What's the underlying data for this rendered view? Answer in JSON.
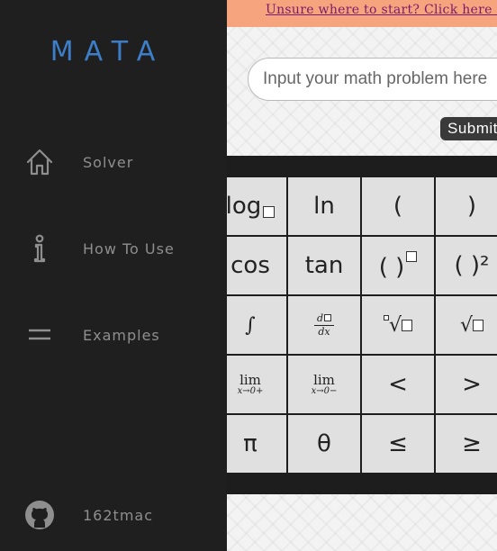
{
  "brand": {
    "logo": "MATA",
    "logo_color": "#3d7ec9"
  },
  "sidebar": {
    "items": [
      {
        "label": "Solver",
        "icon": "home-icon"
      },
      {
        "label": "How To Use",
        "icon": "info-icon"
      },
      {
        "label": "Examples",
        "icon": "menu-icon"
      }
    ],
    "github": {
      "label": "162tmac",
      "icon": "github-icon"
    }
  },
  "banner": {
    "link_text": "Unsure where to start? Click here to",
    "background": "#f6a47e"
  },
  "input": {
    "placeholder": "Input your math problem here",
    "value": ""
  },
  "submit": {
    "label": "Submit"
  },
  "keypad": {
    "row1": [
      "log",
      "ln",
      "(",
      ")"
    ],
    "row2": [
      "cos",
      "tan",
      "( )",
      "( )²"
    ],
    "row3": [
      "∫",
      "d",
      "dx",
      "√"
    ],
    "row4": [
      "lim",
      "x→0+",
      "lim",
      "x→0−",
      "<",
      ">"
    ],
    "row5": [
      "π",
      "θ",
      "≤",
      "≥"
    ]
  }
}
